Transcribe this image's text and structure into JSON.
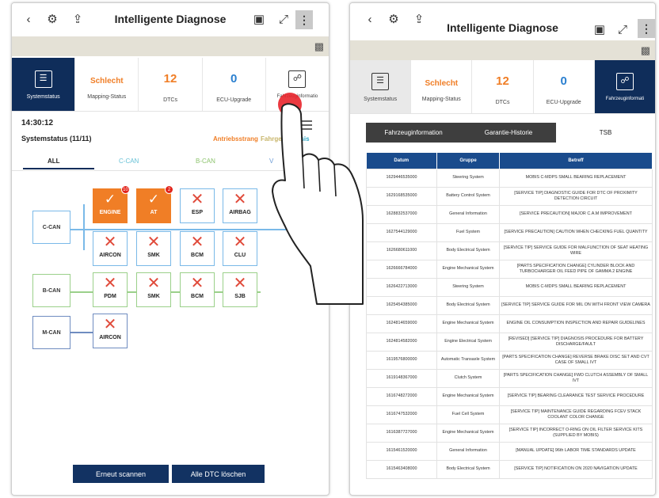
{
  "left": {
    "title": "Intelligente Diagnose",
    "tiles": [
      {
        "value": "",
        "label": "Systemstatus",
        "active": true
      },
      {
        "value": "Schlecht",
        "label": "Mapping-Status"
      },
      {
        "value": "12",
        "label": "DTCs"
      },
      {
        "value": "0",
        "label": "ECU-Upgrade"
      },
      {
        "value": "",
        "label": "Fahrzeuginformatio"
      }
    ],
    "time": "14:30:12",
    "system_status": "Systemstatus (11/11)",
    "filters": {
      "drive": "Antriebsstrang",
      "body": "Fahrgest",
      "chassis": "ssis"
    },
    "can_tabs": {
      "all": "ALL",
      "c": "C-CAN",
      "b": "B-CAN",
      "v": "V"
    },
    "buses": {
      "c": "C-CAN",
      "b": "B-CAN",
      "m": "M-CAN"
    },
    "ecus": {
      "engine": "ENGINE",
      "engine_badge": "10",
      "at": "AT",
      "at_badge": "2",
      "esp": "ESP",
      "airbag": "AIRBAG",
      "aircon": "AIRCON",
      "smk": "SMK",
      "bcm": "BCM",
      "clu": "CLU",
      "pdm": "PDM",
      "smk2": "SMK",
      "bcm2": "BCM",
      "sjb": "SJB",
      "aircon2": "AIRCON"
    },
    "buttons": {
      "rescan": "Erneut scannen",
      "clear": "Alle DTC löschen"
    }
  },
  "right": {
    "title": "Intelligente Diagnose",
    "tiles": [
      {
        "value": "",
        "label": "Systemstatus"
      },
      {
        "value": "Schlecht",
        "label": "Mapping-Status"
      },
      {
        "value": "12",
        "label": "DTCs"
      },
      {
        "value": "0",
        "label": "ECU-Upgrade"
      },
      {
        "value": "",
        "label": "Fahrzeuginformati",
        "active": true
      }
    ],
    "tabs": [
      "Fahrzeuginformation",
      "Garantie-Historie",
      "TSB"
    ],
    "table": {
      "headers": [
        "Datum",
        "Gruppe",
        "Betreff"
      ],
      "rows": [
        [
          "1629446535000",
          "Steering System",
          "MOBIS C-MDPS SMALL BEARING REPLACEMENT"
        ],
        [
          "1629168535000",
          "Battery Control System",
          "[SERVICE TIP] DIAGNOSTIC GUIDE FOR DTC OF PROXIMITY DETECTION CIRCUIT"
        ],
        [
          "1628832537000",
          "General Information",
          "[SERVICE PRECAUTION] MAJOR C.A.M IMPROVEMENT"
        ],
        [
          "1627544129000",
          "Fuel System",
          "[SERVICE PRECAUTION] CAUTION WHEN CHECKING FUEL QUANTITY"
        ],
        [
          "1626680611000",
          "Body Electrical System",
          "[SERVICE TIP] SERVICE GUIDE FOR MALFUNCTION OF SEAT HEATING WIRE"
        ],
        [
          "1626666784000",
          "Engine Mechanical System",
          "[PARTS SPECIFICATION CHANGE] CYLINDER BLOCK AND TURBOCHARGER OIL FEED PIPE OF GAMMA 2 ENGINE"
        ],
        [
          "1626422713000",
          "Steering System",
          "MOBIS C-MDPS SMALL BEARING REPLACEMENT"
        ],
        [
          "1625454385000",
          "Body Electrical System",
          "[SERVICE TIP] SERVICE GUIDE FOR MIL ON WITH FRONT VIEW CAMERA"
        ],
        [
          "1624814659000",
          "Engine Mechanical System",
          "ENGINE OIL CONSUMPTION INSPECTION AND REPAIR GUIDELINES"
        ],
        [
          "1624814582000",
          "Engine Electrical System",
          "[REVISED] [SERVICE TIP] DIAGNOSIS PROCEDURE FOR BATTERY DISCHARGE/FAULT"
        ],
        [
          "1619576800000",
          "Automatic Transaxle System",
          "[PARTS SPECIFICATION CHANGE] REVERSE BRAKE DISC SET AND CVT CASE OF SMALL IVT"
        ],
        [
          "1619148367000",
          "Clutch System",
          "[PARTS SPECIFICATION CHANGE] FWD CLUTCH ASSEMBLY OF SMALL IVT"
        ],
        [
          "1616748272000",
          "Engine Mechanical System",
          "[SERVICE TIP] BEARING CLEARANCE TEST SERVICE PROCEDURE"
        ],
        [
          "1616747532000",
          "Fuel Cell System",
          "[SERVICE TIP] MAINTENANCE GUIDE REGARDING FCEV STACK COOLANT COLOR CHANGE"
        ],
        [
          "1616387727000",
          "Engine Mechanical System",
          "[SERVICE TIP] INCORRECT O-RING ON OIL FILTER SERVICE KITS (SUPPLIED BY MOBIS)"
        ],
        [
          "1615461520000",
          "General Information",
          "[MANUAL UPDATE] 96th LABOR TIME STANDARDS UPDATE"
        ],
        [
          "1615463408000",
          "Body Electrical System",
          "[SERVICE TIP] NOTIFICATION ON 2020 NAVIGATION UPDATE"
        ]
      ]
    }
  }
}
